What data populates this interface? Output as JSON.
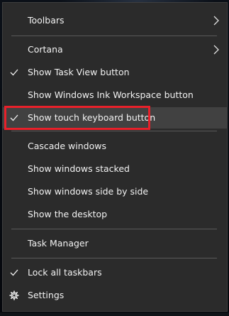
{
  "context_menu": {
    "items": [
      {
        "id": "toolbars",
        "label": "Toolbars",
        "checked": false,
        "submenu": true
      },
      {
        "id": "cortana",
        "label": "Cortana",
        "checked": false,
        "submenu": true
      },
      {
        "id": "show-task-view",
        "label": "Show Task View button",
        "checked": true,
        "submenu": false
      },
      {
        "id": "show-ink-workspace",
        "label": "Show Windows Ink Workspace button",
        "checked": false,
        "submenu": false
      },
      {
        "id": "show-touch-keyboard",
        "label": "Show touch keyboard button",
        "checked": true,
        "submenu": false,
        "highlighted": true
      },
      {
        "id": "cascade-windows",
        "label": "Cascade windows",
        "checked": false,
        "submenu": false
      },
      {
        "id": "windows-stacked",
        "label": "Show windows stacked",
        "checked": false,
        "submenu": false
      },
      {
        "id": "windows-side-by-side",
        "label": "Show windows side by side",
        "checked": false,
        "submenu": false
      },
      {
        "id": "show-desktop",
        "label": "Show the desktop",
        "checked": false,
        "submenu": false
      },
      {
        "id": "task-manager",
        "label": "Task Manager",
        "checked": false,
        "submenu": false
      },
      {
        "id": "lock-taskbars",
        "label": "Lock all taskbars",
        "checked": true,
        "submenu": false
      },
      {
        "id": "settings",
        "label": "Settings",
        "checked": false,
        "submenu": false,
        "icon": "gear-icon"
      }
    ]
  },
  "annotation": {
    "highlight_color": "#e8202a"
  },
  "colors": {
    "menu_background": "#2b2b2b",
    "hover_background": "#414141",
    "separator": "#5a5a5a",
    "text": "#f2f2f2"
  }
}
